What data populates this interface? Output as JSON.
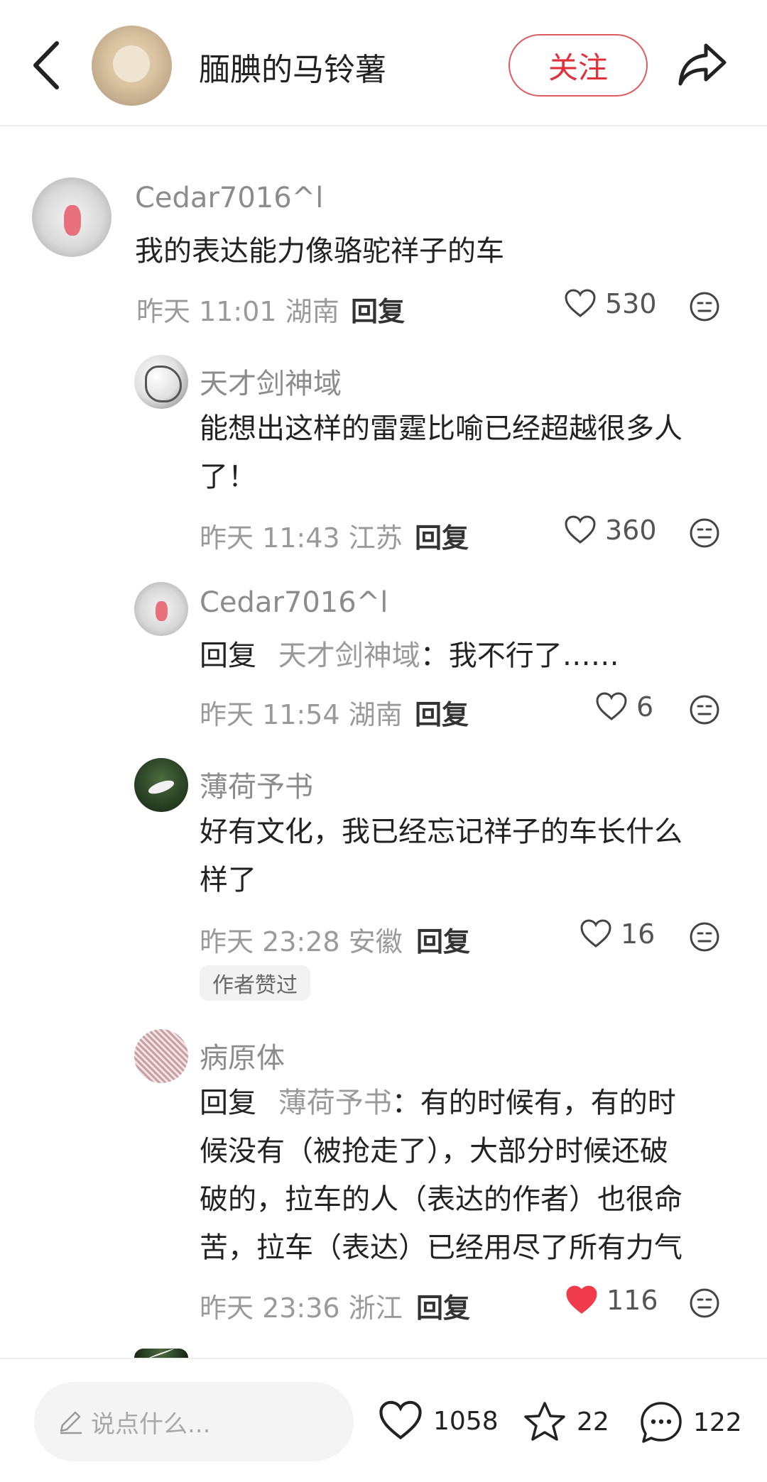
{
  "header": {
    "username": "腼腆的马铃薯",
    "follow_label": "关注"
  },
  "comments": [
    {
      "name": "Cedar7016^l",
      "text": "我的表达能力像骆驼祥子的车",
      "time": "昨天 11:01",
      "location": "湖南",
      "reply_label": "回复",
      "likes": "530",
      "liked": false
    },
    {
      "name": "天才剑神域",
      "text_line1": "能想出这样的雷霆比喻已经超越很多人",
      "text_line2": "了！",
      "time": "昨天 11:43",
      "location": "江苏",
      "reply_label": "回复",
      "likes": "360",
      "liked": false
    },
    {
      "name": "Cedar7016^l",
      "reply_prefix": "回复",
      "reply_to": "天才剑神域",
      "text": "：我不行了……",
      "time": "昨天 11:54",
      "location": "湖南",
      "reply_label": "回复",
      "likes": "6",
      "liked": false
    },
    {
      "name": "薄荷予书",
      "text_line1": "好有文化，我已经忘记祥子的车长什么",
      "text_line2": "样了",
      "time": "昨天 23:28",
      "location": "安徽",
      "reply_label": "回复",
      "likes": "16",
      "liked": false,
      "badge": "作者赞过"
    },
    {
      "name": "病原体",
      "reply_prefix": "回复",
      "reply_to": "薄荷予书",
      "text_line1": "：有的时候有，有的时",
      "text_line2": "候没有（被抢走了），大部分时候还破",
      "text_line3": "破的，拉车的人（表达的作者）也很命",
      "text_line4": "苦，拉车（表达）已经用尽了所有力气",
      "time": "昨天 23:36",
      "location": "浙江",
      "reply_label": "回复",
      "likes": "116",
      "liked": true
    }
  ],
  "bottom_bar": {
    "input_placeholder": "说点什么...",
    "likes": "1058",
    "favorites": "22",
    "comments": "122"
  },
  "colors": {
    "accent": "#e0313b",
    "liked_heart": "#ef3b4b"
  }
}
